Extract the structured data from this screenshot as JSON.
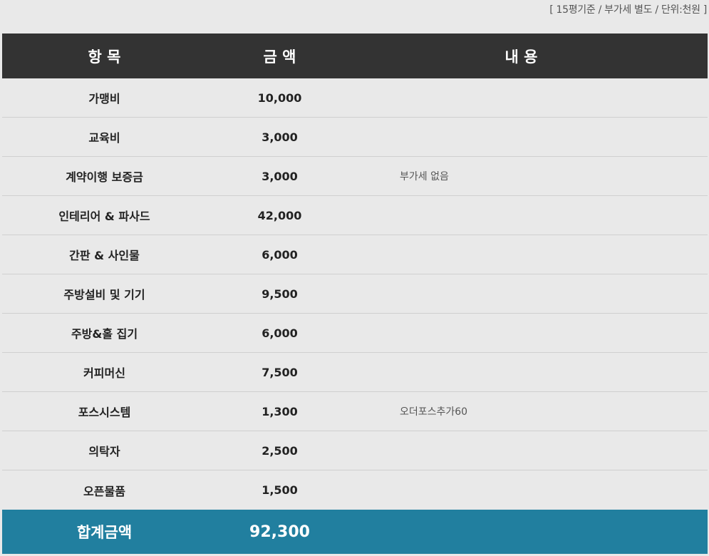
{
  "note": "[ 15평기준 / 부가세 별도 / 단위:천원 ]",
  "header": {
    "item": "항 목",
    "amount": "금 액",
    "content": "내 용"
  },
  "rows": [
    {
      "item": "가맹비",
      "amount": "10,000",
      "content": ""
    },
    {
      "item": "교육비",
      "amount": "3,000",
      "content": ""
    },
    {
      "item": "계약이행 보증금",
      "amount": "3,000",
      "content": "부가세 없음"
    },
    {
      "item": "인테리어 & 파사드",
      "amount": "42,000",
      "content": ""
    },
    {
      "item": "간판 & 사인물",
      "amount": "6,000",
      "content": ""
    },
    {
      "item": "주방설비 및 기기",
      "amount": "9,500",
      "content": ""
    },
    {
      "item": "주방&홀 집기",
      "amount": "6,000",
      "content": ""
    },
    {
      "item": "커피머신",
      "amount": "7,500",
      "content": ""
    },
    {
      "item": "포스시스템",
      "amount": "1,300",
      "content": "오더포스추가60"
    },
    {
      "item": "의탁자",
      "amount": "2,500",
      "content": ""
    },
    {
      "item": "오픈물품",
      "amount": "1,500",
      "content": ""
    }
  ],
  "total": {
    "label": "합계금액",
    "amount": "92,300"
  },
  "colors": {
    "header_bg": "#333333",
    "total_bg": "#217f9f",
    "page_bg": "#e9e9e9"
  }
}
